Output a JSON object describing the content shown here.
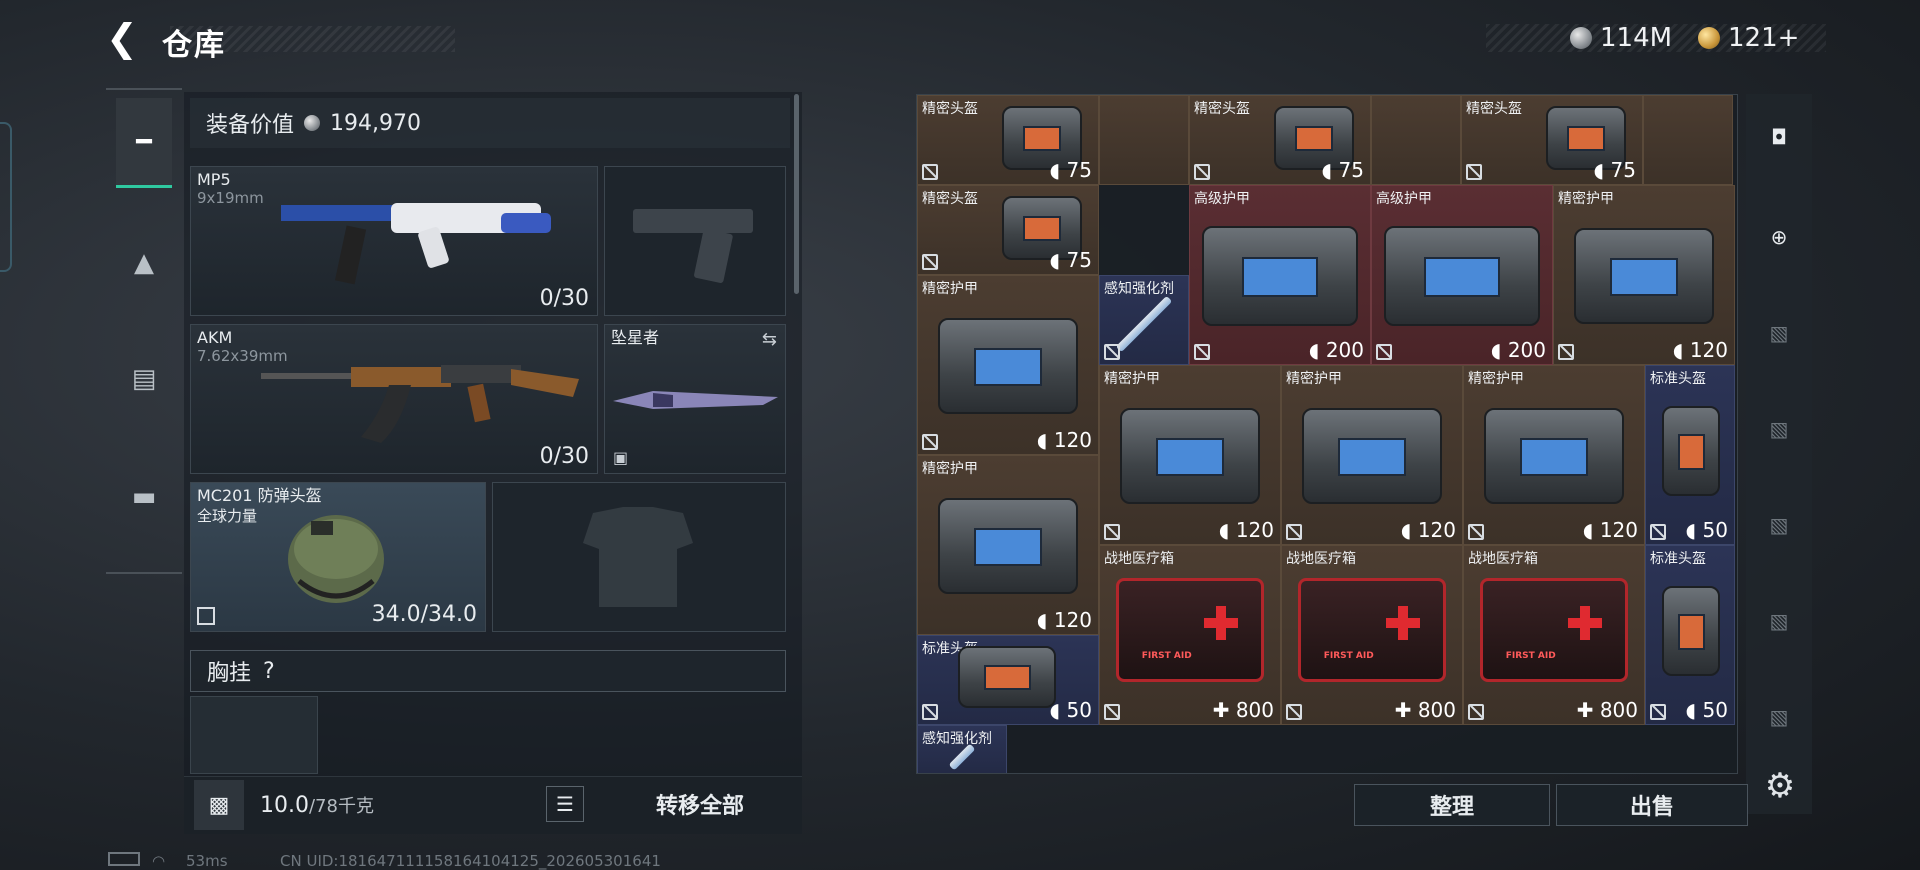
{
  "header": {
    "title": "仓库",
    "currency_silver": "114M",
    "currency_gold": "121+"
  },
  "loadout": {
    "value_label": "装备价值",
    "value": "194,970",
    "primary": {
      "name": "MP5",
      "caliber": "9x19mm",
      "ammo": "0/30"
    },
    "secondary": {
      "name": "AKM",
      "caliber": "7.62x39mm",
      "ammo": "0/30"
    },
    "melee": {
      "name": "坠星者"
    },
    "helmet": {
      "name": "MC201 防弹头盔",
      "sub": "全球力量",
      "durability": "34.0/34.0"
    },
    "chest_label": "胸挂",
    "chest_help": "?",
    "weight": "10.0",
    "weight_max": "/78千克",
    "transfer_all": "转移全部"
  },
  "storage": {
    "items": [
      {
        "name": "精密头盔",
        "value": "75"
      },
      {
        "name": "精密头盔",
        "value": "75"
      },
      {
        "name": "精密头盔",
        "value": "75"
      },
      {
        "name": "精密头盔",
        "value": "75"
      },
      {
        "name": "高级护甲",
        "value": "200"
      },
      {
        "name": "高级护甲",
        "value": "200"
      },
      {
        "name": "精密护甲",
        "value": "120"
      },
      {
        "name": "精密护甲",
        "value": "120"
      },
      {
        "name": "感知强化剂",
        "value": ""
      },
      {
        "name": "精密护甲",
        "value": "120"
      },
      {
        "name": "精密护甲",
        "value": "120"
      },
      {
        "name": "精密护甲",
        "value": "120"
      },
      {
        "name": "标准头盔",
        "value": "50"
      },
      {
        "name": "精密护甲",
        "value": "120"
      },
      {
        "name": "战地医疗箱",
        "value": "800"
      },
      {
        "name": "战地医疗箱",
        "value": "800"
      },
      {
        "name": "战地医疗箱",
        "value": "800"
      },
      {
        "name": "标准头盔",
        "value": "50"
      },
      {
        "name": "标准头盔",
        "value": "50"
      },
      {
        "name": "感知强化剂",
        "value": ""
      }
    ],
    "sort_label": "整理",
    "sell_label": "出售"
  },
  "status": {
    "ping": "53ms",
    "uid": "CN UID:18164711115816410412​5_202605301641"
  },
  "colors": {
    "accent": "#2fc9a0",
    "brown_cell": "#4c3d31",
    "red_cell": "#5a2e33",
    "blue_cell": "#2c3456"
  }
}
